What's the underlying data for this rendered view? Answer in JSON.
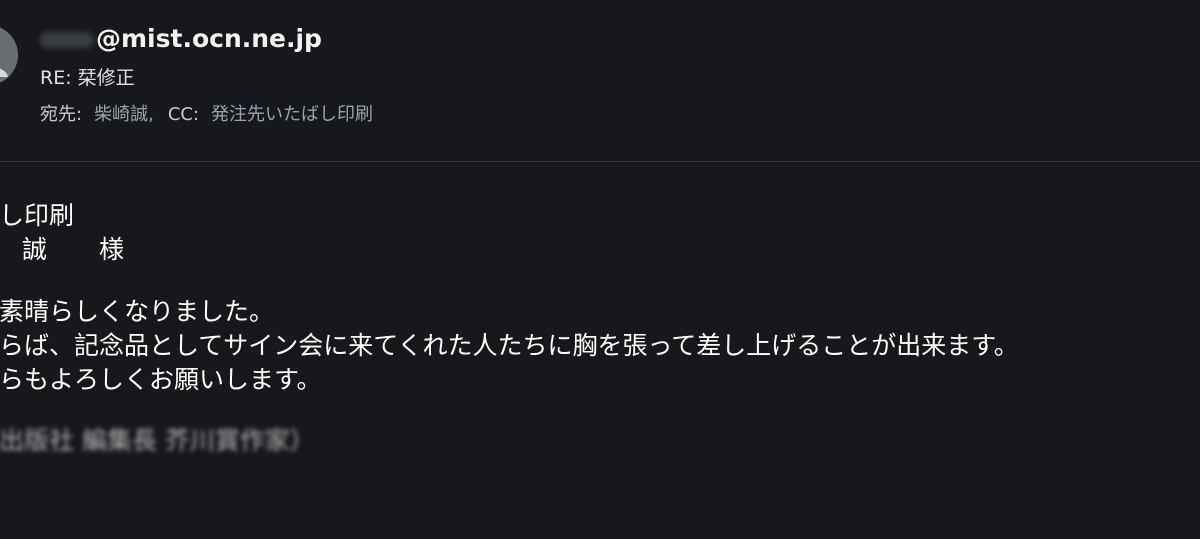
{
  "header": {
    "from_address": "@mist.ocn.ne.jp",
    "subject": "RE: 栞修正",
    "to_label": "宛先:",
    "to_value": "柴崎誠,",
    "cc_label": "CC:",
    "cc_value": "発注先いたばし印刷"
  },
  "body": {
    "lines": [
      "ばし印刷",
      "誠 様",
      "も素晴らしくなりました。",
      "ならば、記念品としてサイン会に来てくれた人たちに胸を張って差し上げることが出来ます。",
      "からもよろしくお願いします。",
      "（出版社 編集長 芥川賞作家）"
    ]
  },
  "colors": {
    "background": "#16181c",
    "divider": "#33383d",
    "recipient_value": "#9aa3ad"
  },
  "icons": {
    "avatar": "person-avatar-icon"
  }
}
